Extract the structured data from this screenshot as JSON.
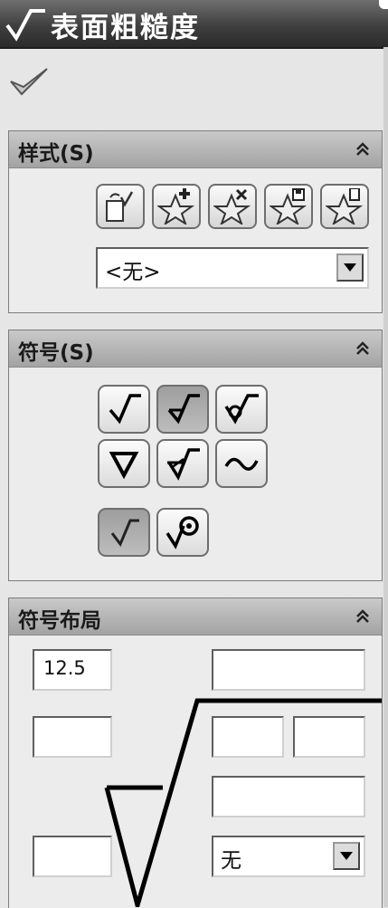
{
  "header": {
    "title": "表面粗糙度",
    "icon": "surface-roughness-icon"
  },
  "actions": {
    "ok_icon": "checkmark-icon"
  },
  "style_panel": {
    "title": "样式(S)",
    "buttons": [
      "update-style-icon",
      "add-style-icon",
      "delete-style-icon",
      "save-style-icon",
      "load-style-icon"
    ],
    "select_value": "<无>"
  },
  "symbol_panel": {
    "title": "符号(S)",
    "symbols": [
      "basic-symbol",
      "machining-required",
      "machining-prohibited",
      "jis-base",
      "jis-machining",
      "jis-no-machining"
    ],
    "selected_symbol_index": 1,
    "selected_modifier_index": 0
  },
  "layout_panel": {
    "title": "符号布局",
    "field_roughness": "12.5",
    "select_value": "无"
  }
}
